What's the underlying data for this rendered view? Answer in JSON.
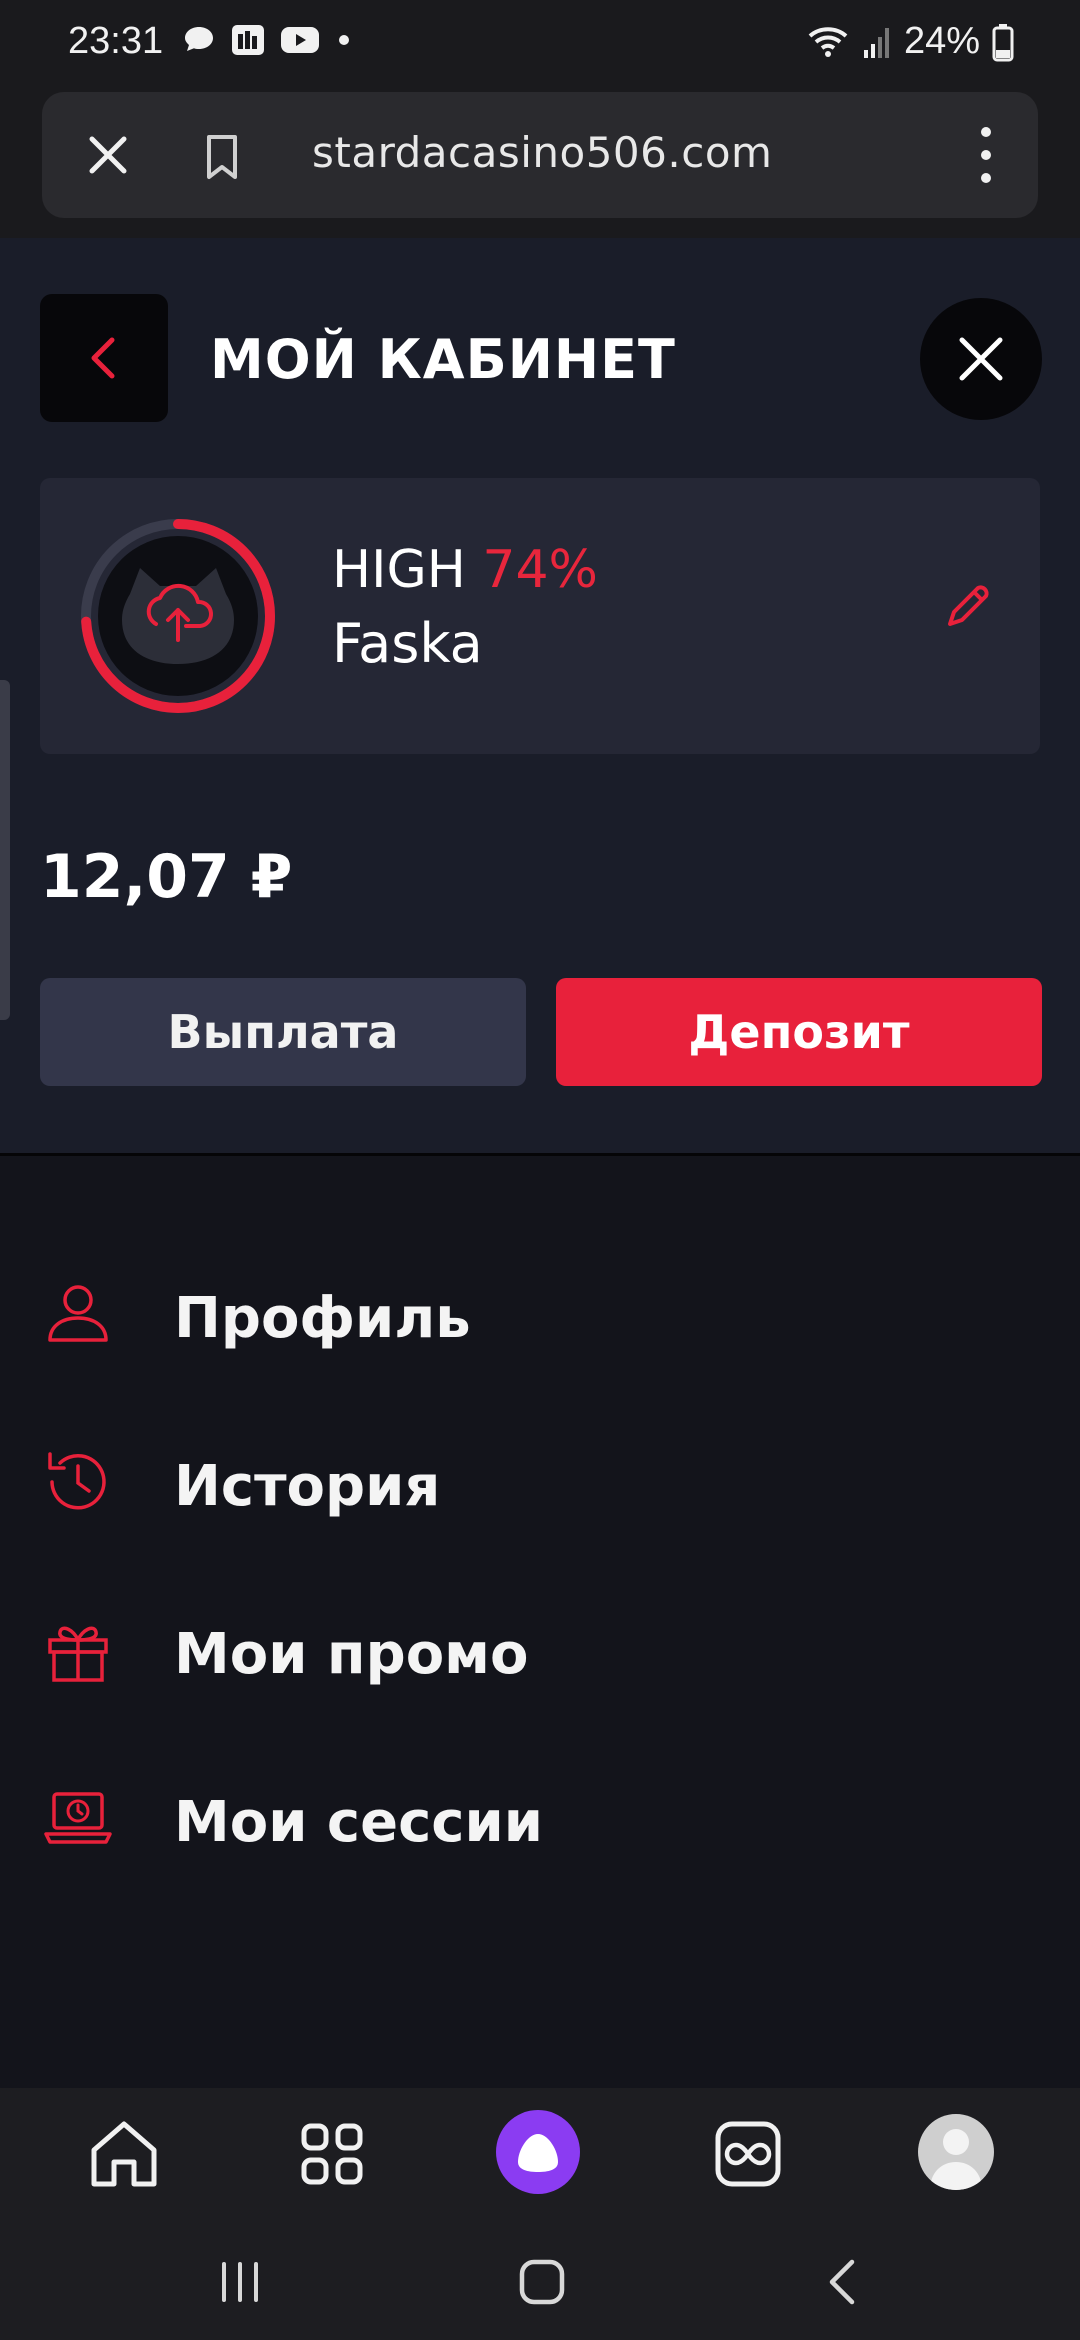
{
  "status_bar": {
    "time": "23:31",
    "battery": "24%",
    "icons": [
      "chat-icon",
      "news-icon",
      "youtube-icon",
      "dot-icon",
      "wifi-icon",
      "signal-icon",
      "battery-icon"
    ]
  },
  "browser": {
    "url": "stardacasino506.com",
    "icons": [
      "close-icon",
      "bookmark-icon",
      "more-vertical-icon"
    ]
  },
  "header": {
    "title": "МОЙ КАБИНЕТ"
  },
  "user": {
    "level_label": "HIGH",
    "level_percent": "74%",
    "level_progress": 0.74,
    "username": "Faska"
  },
  "balance": "12,07 ₽",
  "actions": {
    "withdraw_label": "Выплата",
    "deposit_label": "Депозит"
  },
  "menu": [
    {
      "label": "Профиль",
      "icon": "user-icon"
    },
    {
      "label": "История",
      "icon": "history-icon"
    },
    {
      "label": "Мои промо",
      "icon": "gift-icon"
    },
    {
      "label": "Мои сессии",
      "icon": "laptop-session-icon"
    }
  ],
  "bottom_nav": [
    "home-icon",
    "apps-grid-icon",
    "alice-assistant-icon",
    "infinity-icon",
    "profile-avatar"
  ],
  "system_nav": [
    "recent-apps-icon",
    "home-circle-icon",
    "back-icon"
  ],
  "colors": {
    "accent": "#e8213b",
    "background": "#13141b",
    "panel": "#1a1d29",
    "card": "#252735",
    "secondary_button": "#33364a"
  }
}
